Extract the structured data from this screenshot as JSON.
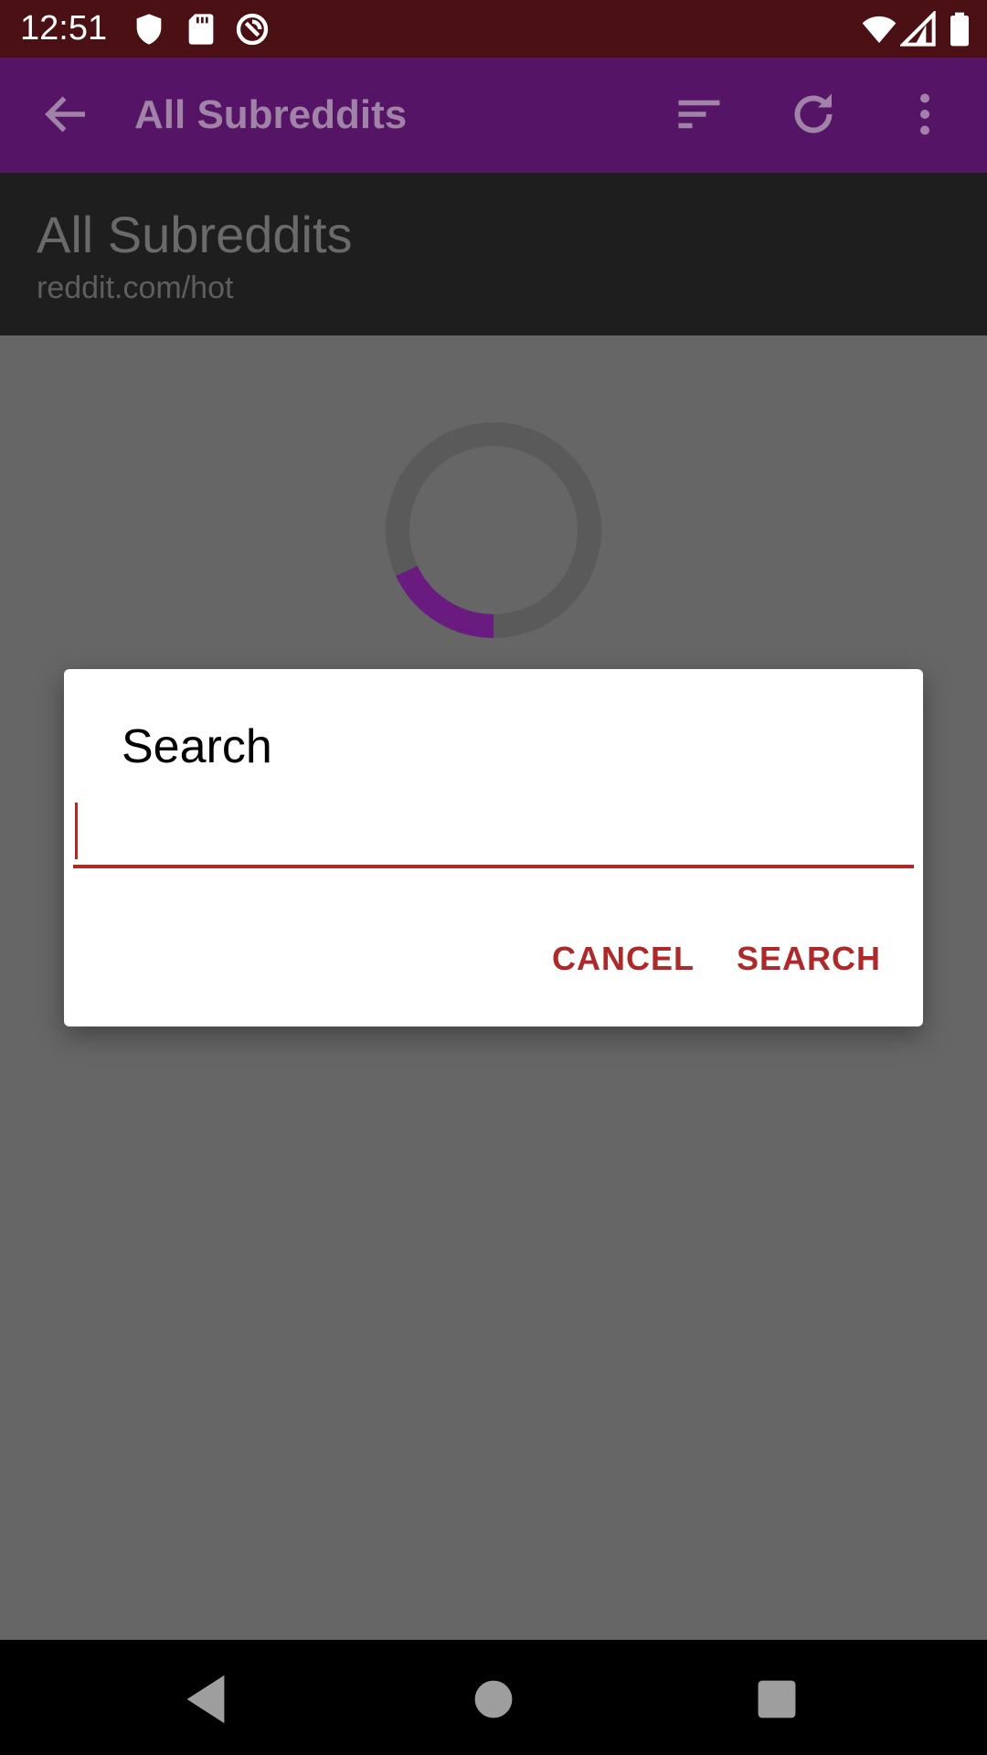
{
  "status_bar": {
    "time": "12:51",
    "icons": [
      "shield-icon",
      "sd-card-icon",
      "sync-off-icon",
      "wifi-icon",
      "signal-icon",
      "battery-icon"
    ]
  },
  "toolbar": {
    "title": "All Subreddits",
    "icons": [
      "back-arrow-icon",
      "sort-icon",
      "refresh-icon",
      "more-vert-icon"
    ]
  },
  "header": {
    "title": "All Subreddits",
    "url": "reddit.com/hot"
  },
  "loading": {
    "progress": 0.18,
    "accent": "#6a1b7f"
  },
  "dialog": {
    "title": "Search",
    "input_value": "",
    "cancel_label": "CANCEL",
    "search_label": "SEARCH",
    "accent": "#ad2a2a"
  },
  "nav_bar": {
    "icons": [
      "back-triangle-icon",
      "home-circle-icon",
      "recents-square-icon"
    ]
  }
}
